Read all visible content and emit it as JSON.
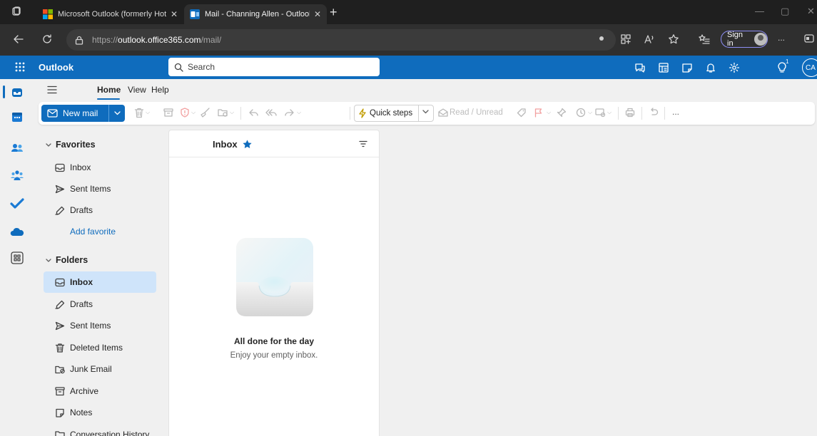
{
  "browser": {
    "tabs": [
      {
        "title": "Microsoft Outlook (formerly Hot",
        "active": false
      },
      {
        "title": "Mail - Channing Allen - Outlook",
        "active": true
      }
    ],
    "url": {
      "prefix": "https://",
      "host": "outlook.office365.com",
      "path": "/mail/"
    },
    "sign_in_label": "Sign in",
    "more_label": "..."
  },
  "header": {
    "app_name": "Outlook",
    "search_placeholder": "Search",
    "notification_badge": "1",
    "user_initials": "CA",
    "brand_color": "#0f6cbd"
  },
  "ribbon": {
    "tabs": [
      "Home",
      "View",
      "Help"
    ],
    "active_tab": "Home",
    "new_mail_label": "New mail",
    "quick_steps_label": "Quick steps",
    "read_unread_label": "Read / Unread",
    "more_label": "..."
  },
  "folders": {
    "favorites_header": "Favorites",
    "favorites": [
      {
        "label": "Inbox",
        "icon": "inbox-icon"
      },
      {
        "label": "Sent Items",
        "icon": "send-icon"
      },
      {
        "label": "Drafts",
        "icon": "pencil-icon"
      }
    ],
    "add_favorite_label": "Add favorite",
    "folders_header": "Folders",
    "items": [
      {
        "label": "Inbox",
        "icon": "inbox-icon",
        "selected": true
      },
      {
        "label": "Drafts",
        "icon": "pencil-icon"
      },
      {
        "label": "Sent Items",
        "icon": "send-icon"
      },
      {
        "label": "Deleted Items",
        "icon": "trash-icon"
      },
      {
        "label": "Junk Email",
        "icon": "junk-icon"
      },
      {
        "label": "Archive",
        "icon": "archive-icon"
      },
      {
        "label": "Notes",
        "icon": "note-icon"
      },
      {
        "label": "Conversation History",
        "icon": "folder-icon"
      }
    ]
  },
  "message_list": {
    "title": "Inbox",
    "empty_title": "All done for the day",
    "empty_subtitle": "Enjoy your empty inbox."
  }
}
